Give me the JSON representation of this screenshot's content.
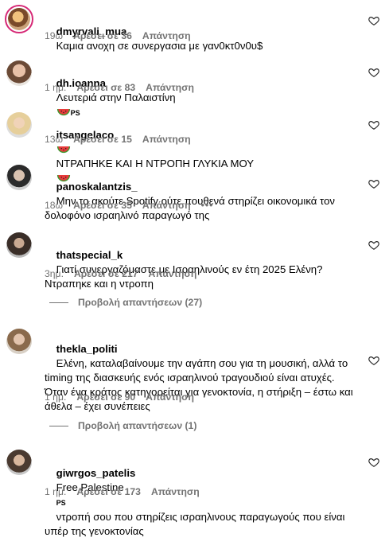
{
  "comments": [
    {
      "user": "dmyrvali_mua",
      "text": "Καμια ανοχη σε συνεργασια με γαν0κτ0ν0υ$",
      "time": "19ω",
      "likes": "Αρέσει σε 36",
      "reply": "Απάντηση"
    },
    {
      "user": "dh.ioanna",
      "text": "Λευτεριά στην Παλαιστίνη",
      "flag": "PS",
      "time": "1 ημ.",
      "likes": "Αρέσει σε 83",
      "reply": "Απάντηση"
    },
    {
      "user": "itsangelaco",
      "text": "ΝΤΡΑΠΗΚΕ ΚΑΙ Η ΝΤΡΟΠΗ ΓΛΥΚΙΑ ΜΟΥ",
      "time": "13ω",
      "likes": "Αρέσει σε 15",
      "reply": "Απάντηση"
    },
    {
      "user": "panoskalantzis_",
      "text": "Μην το ακούτε Spotify ούτε πουθενά στηρίζει οικονομικά τον δολοφόνο ισραηλινό παραγωγό της",
      "time": "18ω",
      "likes": "Αρέσει σε 35",
      "reply": "Απάντηση",
      "more": "•••"
    },
    {
      "user": "thatspecial_k",
      "text": "Γιατί συνεργαζόμαστε με Ισραηλινούς εν έτη 2025 Ελένη? Ντραπηκε και η ντροπη",
      "time": "3ημ.",
      "likes": "Αρέσει σε 217",
      "reply": "Απάντηση",
      "view_replies": "Προβολή απαντήσεων (27)"
    },
    {
      "user": "thekla_politi",
      "text": "Ελένη, καταλαβαίνουμε την αγάπη σου για τη μουσική, αλλά το timing της διασκευής ενός ισραηλινού τραγουδιού είναι ατυχές. Όταν ένα κράτος κατηγορείται για γενοκτονία, η στήριξη – έστω και άθελα – έχει συνέπειες",
      "time": "1 ημ.",
      "likes": "Αρέσει σε 90",
      "reply": "Απάντηση",
      "view_replies": "Προβολή απαντήσεων (1)"
    },
    {
      "user": "giwrgos_patelis",
      "text": "Free Palestine",
      "flag": "PS",
      "text2": "ντροπή σου που στηρίζεις ισραηλινους παραγωγούς που είναι υπέρ της γενοκτονίας",
      "time": "1 ημ.",
      "likes": "Αρέσει σε 173",
      "reply": "Απάντηση"
    }
  ],
  "icons": {
    "heart": "heart-outline-icon",
    "watermelon": "watermelon-emoji"
  },
  "colors": {
    "meta": "#737373",
    "text": "#000000",
    "background": "#ffffff"
  }
}
